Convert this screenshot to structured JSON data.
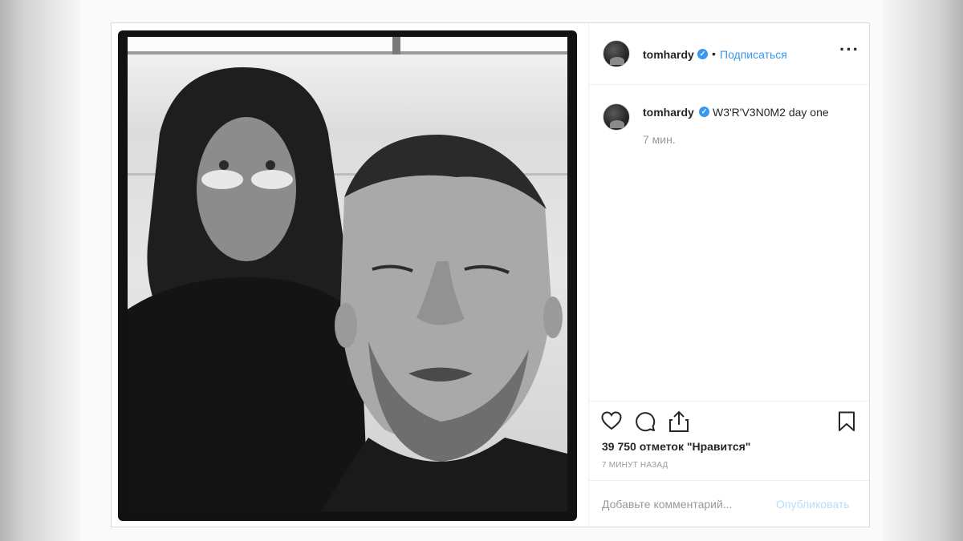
{
  "header": {
    "username": "tomhardy",
    "verified_mark": "✓",
    "separator": "•",
    "follow_label": "Подписаться",
    "more_label": "···"
  },
  "caption": {
    "username": "tomhardy",
    "verified_mark": "✓",
    "text": "W3'R'V3N0M2 day one",
    "time": "7 мин."
  },
  "actions": {
    "icons": [
      "heart-icon",
      "comment-icon",
      "share-icon",
      "bookmark-icon"
    ],
    "likes": "39 750 отметок \"Нравится\"",
    "timestamp": "7 МИНУТ НАЗАД"
  },
  "comment": {
    "placeholder": "Добавьте комментарий...",
    "post_label": "Опубликовать"
  },
  "colors": {
    "link": "#3897f0",
    "verified": "#3897f0",
    "muted": "#999999",
    "post_disabled": "#b2dffc",
    "border": "#dbdbdb"
  }
}
